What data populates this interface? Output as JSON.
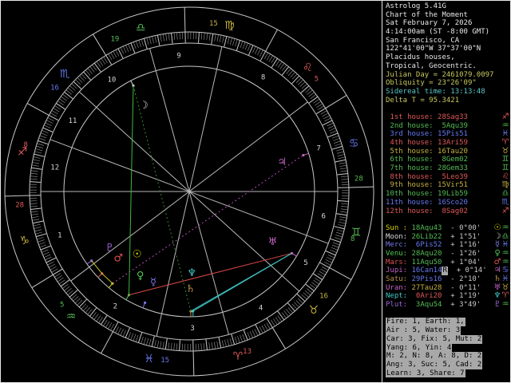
{
  "app_title": "Astrolog 5.41G",
  "colors": {
    "white": "#e8e8e8",
    "gray": "#c8c8c8",
    "olive": "#c8c860",
    "cyan": "#58c8c8",
    "fire": "#e05858",
    "earth": "#c4b040",
    "air": "#55bb55",
    "water": "#6678ee",
    "sun": "#d8d800",
    "moon": "#d8d8d8",
    "merc": "#7878e8",
    "venu": "#50c850",
    "mars": "#e05050",
    "jupi": "#c060c0",
    "satu": "#b89048",
    "uran": "#c864c8",
    "nept": "#40c8c8",
    "plut": "#9868d8",
    "ring": "#c8c8c8",
    "tick": "#989898",
    "housenum": "#d8d8d8",
    "aspect_conj": "#c8c830",
    "aspect_trine": "#40b840",
    "aspect_square": "#d84848",
    "aspect_sextile": "#40c0c0",
    "aspect_quincunx_g": "#2f8f2f",
    "aspect_quincunx_m": "#b050b0",
    "inverse_bg": "#a8a8a8",
    "inverse_fg": "#000000"
  },
  "panel": {
    "info_lines": [
      {
        "text": "Astrolog 5.41G",
        "color": "white"
      },
      {
        "text": "Chart of the Moment",
        "color": "white"
      },
      {
        "text": "Sat February 7, 2026",
        "color": "white"
      },
      {
        "text": "4:14:00am (ST -8:00 GMT)",
        "color": "white"
      },
      {
        "text": "San Francisco, CA",
        "color": "white"
      },
      {
        "text": "122°41'00\"W 37°37'00\"N",
        "color": "white"
      },
      {
        "text": "Placidus houses,",
        "color": "white"
      },
      {
        "text": "Tropical, Geocentric.",
        "color": "white"
      },
      {
        "text": "Julian Day = 2461079.0097",
        "color": "olive"
      },
      {
        "text": "Obliquity = 23°26'09\"",
        "color": "olive"
      },
      {
        "text": "Sidereal time: 13:13:48",
        "color": "cyan"
      },
      {
        "text": "Delta T = 95.3421",
        "color": "olive"
      }
    ],
    "houses": [
      {
        "label": " 1st house: 28Sag33",
        "element": "fire",
        "glyph": "♐"
      },
      {
        "label": " 2nd house:  5Aqu39",
        "element": "air",
        "glyph": "♒"
      },
      {
        "label": " 3rd house: 15Pis51",
        "element": "water",
        "glyph": "♓"
      },
      {
        "label": " 4th house: 13Ari59",
        "element": "fire",
        "glyph": "♈"
      },
      {
        "label": " 5th house: 16Tau20",
        "element": "earth",
        "glyph": "♉"
      },
      {
        "label": " 6th house:  8Gem02",
        "element": "air",
        "glyph": "♊"
      },
      {
        "label": " 7th house: 28Gem33",
        "element": "air",
        "glyph": "♊"
      },
      {
        "label": " 8th house:  5Leo39",
        "element": "fire",
        "glyph": "♌"
      },
      {
        "label": " 9th house: 15Vir51",
        "element": "earth",
        "glyph": "♍"
      },
      {
        "label": "10th house: 19Lib59",
        "element": "air",
        "glyph": "♎"
      },
      {
        "label": "11th house: 16Sco20",
        "element": "water",
        "glyph": "♏"
      },
      {
        "label": "12th house:  8Sag02",
        "element": "fire",
        "glyph": "♐"
      }
    ],
    "planets": [
      {
        "name": "Sun :",
        "pos": "18Aqu43",
        "vel": "- 0°00'",
        "color": "sun",
        "element": "air",
        "pglyph": "☉",
        "sglyph": "♒",
        "retro": false
      },
      {
        "name": "Moon:",
        "pos": "26Lib22",
        "vel": "+ 1°51'",
        "color": "moon",
        "element": "air",
        "pglyph": "☽",
        "sglyph": "♎",
        "retro": false
      },
      {
        "name": "Merc:",
        "pos": " 6Pis52",
        "vel": "+ 1°16'",
        "color": "merc",
        "element": "water",
        "pglyph": "☿",
        "sglyph": "♓",
        "retro": false
      },
      {
        "name": "Venu:",
        "pos": "28Aqu20",
        "vel": "- 1°26'",
        "color": "venu",
        "element": "air",
        "pglyph": "♀",
        "sglyph": "♒",
        "retro": false
      },
      {
        "name": "Mars:",
        "pos": "11Aqu50",
        "vel": "+ 1°04'",
        "color": "mars",
        "element": "air",
        "pglyph": "♂",
        "sglyph": "♒",
        "retro": false
      },
      {
        "name": "Jupi:",
        "pos": "16Can14",
        "vel": "+ 0°14'",
        "color": "jupi",
        "element": "water",
        "pglyph": "♃",
        "sglyph": "♋",
        "retro": true
      },
      {
        "name": "Satu:",
        "pos": "29Pis16",
        "vel": "- 2°10'",
        "color": "satu",
        "element": "water",
        "pglyph": "♄",
        "sglyph": "♓",
        "retro": false
      },
      {
        "name": "Uran:",
        "pos": "27Tau28",
        "vel": "- 0°11'",
        "color": "uran",
        "element": "earth",
        "pglyph": "♅",
        "sglyph": "♉",
        "retro": false
      },
      {
        "name": "Nept:",
        "pos": " 0Ari20",
        "vel": "+ 1°19'",
        "color": "nept",
        "element": "fire",
        "pglyph": "♆",
        "sglyph": "♈",
        "retro": false
      },
      {
        "name": "Plut:",
        "pos": " 3Aqu54",
        "vel": "+ 3°49'",
        "color": "plut",
        "element": "air",
        "pglyph": "♇",
        "sglyph": "♒",
        "retro": false
      }
    ],
    "summary": [
      "Fire: 1, Earth: 1,",
      "Air : 5, Water: 3",
      "Car: 3, Fix: 5, Mut: 2",
      "Yang: 6, Yin: 4",
      "M: 2, N: 8, A: 8, D: 2",
      "Ang: 3, Suc: 5, Cad: 2",
      "Learn: 3, Share: 7"
    ],
    "retro_badge": "R"
  },
  "wheel": {
    "ascendant": 268.55,
    "signs": [
      {
        "glyph": "♈",
        "element": "fire",
        "lon": 15
      },
      {
        "glyph": "♉",
        "element": "earth",
        "lon": 45
      },
      {
        "glyph": "♊",
        "element": "air",
        "lon": 75
      },
      {
        "glyph": "♋",
        "element": "water",
        "lon": 105
      },
      {
        "glyph": "♌",
        "element": "fire",
        "lon": 135
      },
      {
        "glyph": "♍",
        "element": "earth",
        "lon": 165
      },
      {
        "glyph": "♎",
        "element": "air",
        "lon": 195
      },
      {
        "glyph": "♏",
        "element": "water",
        "lon": 225
      },
      {
        "glyph": "♐",
        "element": "fire",
        "lon": 255
      },
      {
        "glyph": "♑",
        "element": "earth",
        "lon": 285
      },
      {
        "glyph": "♒",
        "element": "air",
        "lon": 315
      },
      {
        "glyph": "♓",
        "element": "water",
        "lon": 345
      }
    ],
    "cusps": [
      {
        "lon": 268.55,
        "deg": "28",
        "element": "fire"
      },
      {
        "lon": 305.65,
        "deg": "5",
        "element": "air"
      },
      {
        "lon": 345.85,
        "deg": "15",
        "element": "water"
      },
      {
        "lon": 13.98,
        "deg": "13",
        "element": "fire"
      },
      {
        "lon": 46.33,
        "deg": "16",
        "element": "earth"
      },
      {
        "lon": 68.03,
        "deg": "8",
        "element": "air"
      },
      {
        "lon": 88.55,
        "deg": "28",
        "element": "air"
      },
      {
        "lon": 125.65,
        "deg": "5",
        "element": "fire"
      },
      {
        "lon": 165.85,
        "deg": "15",
        "element": "earth"
      },
      {
        "lon": 199.98,
        "deg": "19",
        "element": "air"
      },
      {
        "lon": 226.33,
        "deg": "16",
        "element": "water"
      },
      {
        "lon": 248.03,
        "deg": "8",
        "element": "fire"
      }
    ],
    "house_numbers": [
      "1",
      "2",
      "3",
      "4",
      "5",
      "6",
      "7",
      "8",
      "9",
      "10",
      "11",
      "12"
    ],
    "planets": [
      {
        "id": "sun",
        "glyph": "☉",
        "lon": 318.72
      },
      {
        "id": "moon",
        "glyph": "☽",
        "lon": 206.37
      },
      {
        "id": "merc",
        "glyph": "☿",
        "lon": 336.87
      },
      {
        "id": "venu",
        "glyph": "♀",
        "lon": 328.33
      },
      {
        "id": "mars",
        "glyph": "♂",
        "lon": 311.83
      },
      {
        "id": "jupi",
        "glyph": "♃",
        "lon": 106.23
      },
      {
        "id": "satu",
        "glyph": "♄",
        "lon": 359.27
      },
      {
        "id": "uran",
        "glyph": "♅",
        "lon": 57.47
      },
      {
        "id": "nept",
        "glyph": "♆",
        "lon": 0.33
      },
      {
        "id": "plut",
        "glyph": "♇",
        "lon": 303.9
      }
    ],
    "aspects": [
      {
        "a": "sun",
        "b": "mars",
        "color": "aspect_conj",
        "dotted": false
      },
      {
        "a": "mars",
        "b": "plut",
        "color": "aspect_conj",
        "dotted": false
      },
      {
        "a": "satu",
        "b": "nept",
        "color": "aspect_conj",
        "dotted": false
      },
      {
        "a": "moon",
        "b": "venu",
        "color": "aspect_trine",
        "dotted": false
      },
      {
        "a": "venu",
        "b": "uran",
        "color": "aspect_square",
        "dotted": false
      },
      {
        "a": "satu",
        "b": "uran",
        "color": "aspect_sextile",
        "dotted": false
      },
      {
        "a": "nept",
        "b": "uran",
        "color": "aspect_sextile",
        "dotted": false
      },
      {
        "a": "moon",
        "b": "satu",
        "color": "aspect_quincunx_g",
        "dotted": true
      },
      {
        "a": "sun",
        "b": "jupi",
        "color": "aspect_quincunx_m",
        "dotted": true
      }
    ]
  }
}
